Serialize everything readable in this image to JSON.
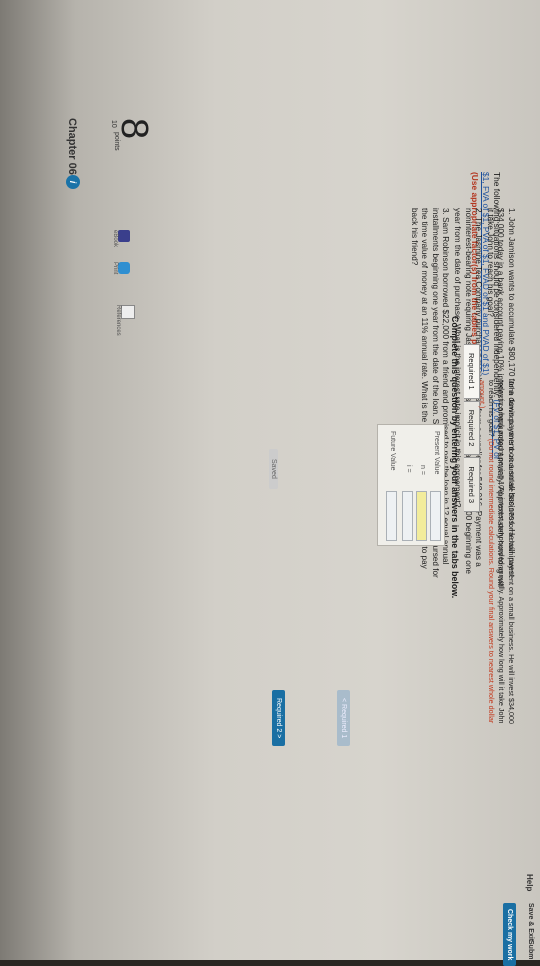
{
  "header": {
    "chapter_title": "Chapter 06",
    "info_badge": "i",
    "saved_label": "Saved",
    "help_label": "Help",
    "save_exit_label": "Save & Exit",
    "submit_label": "Subm",
    "check_work_label": "Check my work"
  },
  "question": {
    "number": "8",
    "points_value": "10",
    "points_label": "points"
  },
  "sidebar": {
    "items": [
      {
        "label": "eBook",
        "icon": "ebook-icon"
      },
      {
        "label": "Print",
        "icon": "print-icon"
      },
      {
        "label": "References",
        "icon": "references-icon"
      }
    ]
  },
  "intro": {
    "text": "The following situations should be considered independently.",
    "links": "(FV of $1, PV of $1, FVA of $1, PVA of $1, FVAD of $1 and PVAD of $1)",
    "note": "(Use appropriate factor(s) from the tables provided.)"
  },
  "items": [
    "1. John Jamison wants to accumulate $80,170 for a down payment on a small business. He will invest $34,000 today in a bank account paying 10% interest compounded annually. Approximately how long will it take John to reach his goal?",
    "2. The Jasmine Tea Company purchased merchandise from a supplier for $48,016. Payment was a noninterest-bearing note requiring Jasmine to make seven annual payments of $8,000 beginning one year from the date of purchase. What is the interest rate implicit in this agreement?",
    "3. Sam Robinson borrowed $22,000 from a friend and promised to pay the loan in 12 equal annual installments beginning one year from the date of the loan. Sam's friend would like to be reimbursed for the time value of money at an 11% annual rate. What is the annual payment Sam must make to pay back his friend?"
  ],
  "complete_label": "Complete this question by entering your answers in the tabs below.",
  "tabs": [
    "Required 1",
    "Required 2",
    "Required 3"
  ],
  "instructions": {
    "main": "John Jamison wants to accumulate $80,170 for a down payment on a small business. He will invest $34,000 today in a bank account paying 10% interest compounded annually. Approximately how long will it take John to reach his goal?",
    "red": "(Do not round intermediate calculations. Round your final answers to nearest whole dollar amount.)"
  },
  "table": {
    "present_value_label": "Present Value",
    "n_label": "n =",
    "i_label": "i =",
    "future_value_label": "Future Value"
  },
  "nav": {
    "prev_label": "< Required 1",
    "next_label": "Required 2  >"
  },
  "colors": {
    "accent": "#1a6fa3",
    "warning_text": "#b3361f",
    "input_highlight": "#f2ec9c"
  }
}
